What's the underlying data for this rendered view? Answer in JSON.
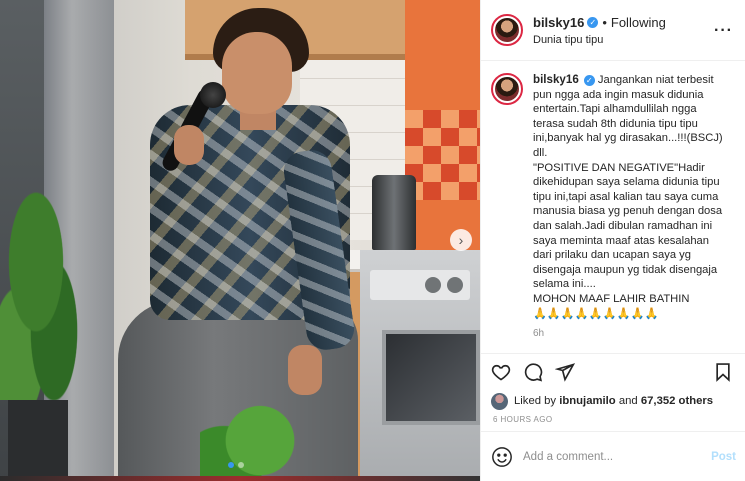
{
  "post": {
    "username": "bilsky16",
    "follow_status": "Following",
    "location": "Dunia tipu tipu",
    "caption_username": "bilsky16",
    "caption": "Jangankan niat terbesit pun ngga ada ingin masuk didunia entertain.Tapi alhamdullilah ngga terasa sudah 8th didunia tipu tipu ini,banyak hal yg dirasakan...!!!(BSCJ) dll.\n\"POSITIVE DAN NEGATIVE\"Hadir dikehidupan saya selama didunia tipu tipu ini,tapi asal kalian tau saya cuma manusia biasa yg penuh dengan dosa dan salah.Jadi dibulan ramadhan ini saya meminta maaf atas kesalahan dari prilaku dan ucapan saya yg disengaja maupun yg tidak disengaja selama ini....\nMOHON MAAF LAHIR BATHIN\n🙏🙏🙏🙏🙏🙏🙏🙏🙏",
    "caption_age": "6h",
    "liked_by_prefix": "Liked by",
    "liked_by_user": "ibnujamilo",
    "liked_by_and": "and",
    "liked_by_count": "67,352 others",
    "posted_ago": "6 HOURS AGO"
  },
  "comment_box": {
    "placeholder": "Add a comment...",
    "post_label": "Post"
  },
  "icons": {
    "more": "more-options-icon",
    "like": "heart-icon",
    "comment": "comment-bubble-icon",
    "share": "paper-plane-icon",
    "save": "bookmark-icon",
    "emoji": "emoji-smiley-icon",
    "next": "chevron-right-icon",
    "verified": "verified-badge-icon"
  },
  "carousel": {
    "next_glyph": "›",
    "total_slides": 2,
    "active_slide": 1
  },
  "colors": {
    "accent": "#3897f0",
    "text": "#262626",
    "muted": "#8e8e8e",
    "post_disabled": "#b2dffc",
    "avatar_ring": "#dc2743"
  }
}
